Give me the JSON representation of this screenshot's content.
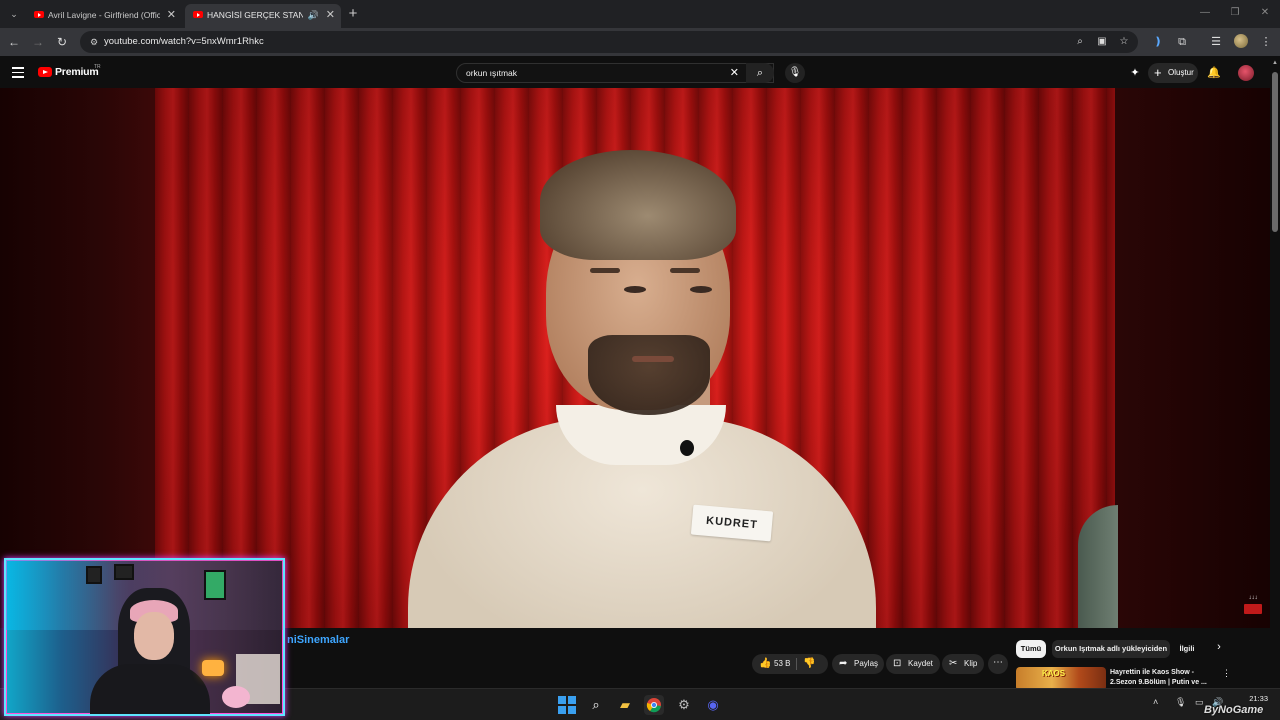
{
  "browser": {
    "tabs": [
      {
        "title": "Avril Lavigne - Girlfriend (Official",
        "active": false,
        "audio": false
      },
      {
        "title": "HANGİSİ GERÇEK STAND-U",
        "active": true,
        "audio": true
      }
    ],
    "url": "youtube.com/watch?v=5nxWmr1Rhkc"
  },
  "youtube": {
    "brand": "Premium",
    "country": "TR",
    "search_value": "orkun ışıtmak",
    "create_label": "Oluştur"
  },
  "video": {
    "name_tag": "KUDRET",
    "corner_badge": "↓↓↓"
  },
  "below_video": {
    "channel_name": "niSinemalar",
    "like_count": "53 B",
    "share_label": "Paylaş",
    "save_label": "Kaydet",
    "clip_label": "Klip"
  },
  "recommendations": {
    "chips": [
      "Tümü",
      "Orkun Işıtmak adlı yükleyiciden",
      "İlgili"
    ],
    "selected_chip": "Tümü",
    "item": {
      "title": "Hayrettin ile Kaos Show - 2.Sezon 9.Bölüm | Putin ve ...",
      "thumb_text": "KAOS"
    }
  },
  "taskbar": {
    "time": "21:33",
    "watermark": "ByNoGame"
  },
  "colors": {
    "accent_blue": "#3ea6ff",
    "youtube_red": "#ff0000",
    "webcam_border": "#5fe6ff"
  }
}
